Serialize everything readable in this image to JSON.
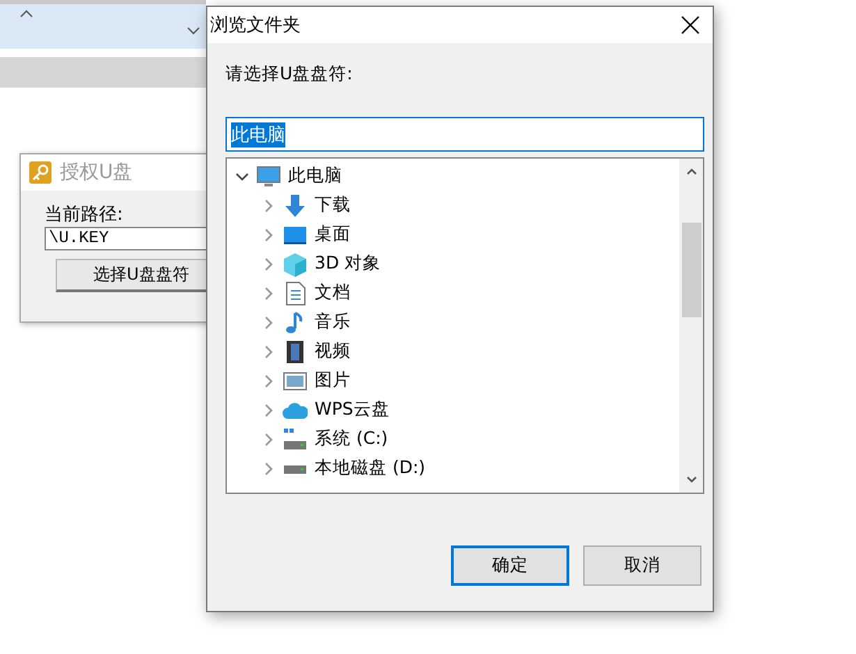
{
  "back_window": {
    "title": "授权U盘",
    "path_label": "当前路径:",
    "path_value": "\\U.KEY",
    "button": "选择U盘盘符"
  },
  "dialog": {
    "title": "浏览文件夹",
    "prompt": "请选择U盘盘符:",
    "field_value": "此电脑",
    "tree": {
      "label": "此电脑",
      "kind": "pc",
      "expanded": true,
      "children": [
        {
          "label": "下载",
          "kind": "download",
          "expanded": false
        },
        {
          "label": "桌面",
          "kind": "desktop",
          "expanded": false
        },
        {
          "label": "3D 对象",
          "kind": "cube",
          "expanded": false
        },
        {
          "label": "文档",
          "kind": "document",
          "expanded": false
        },
        {
          "label": "音乐",
          "kind": "music",
          "expanded": false
        },
        {
          "label": "视频",
          "kind": "video",
          "expanded": false
        },
        {
          "label": "图片",
          "kind": "picture",
          "expanded": false
        },
        {
          "label": "WPS云盘",
          "kind": "cloud",
          "expanded": false
        },
        {
          "label": "系统 (C:)",
          "kind": "systemdrive",
          "expanded": false
        },
        {
          "label": "本地磁盘 (D:)",
          "kind": "drive",
          "expanded": false
        }
      ]
    },
    "buttons": [
      {
        "label": "确定",
        "default": true
      },
      {
        "label": "取消",
        "default": false
      }
    ]
  }
}
